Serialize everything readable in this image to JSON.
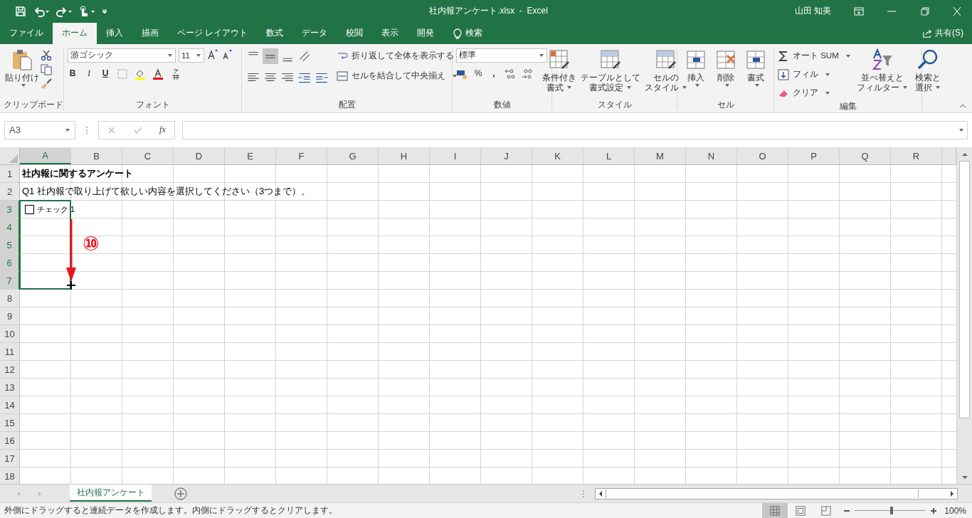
{
  "window": {
    "title": "社内報アンケート.xlsx  -  Excel",
    "user": "山田 知美"
  },
  "ribbon_tabs": [
    {
      "label": "ファイル",
      "selected": false
    },
    {
      "label": "ホーム",
      "selected": true
    },
    {
      "label": "挿入",
      "selected": false
    },
    {
      "label": "描画",
      "selected": false
    },
    {
      "label": "ページ レイアウト",
      "selected": false
    },
    {
      "label": "数式",
      "selected": false
    },
    {
      "label": "データ",
      "selected": false
    },
    {
      "label": "校閲",
      "selected": false
    },
    {
      "label": "表示",
      "selected": false
    },
    {
      "label": "開発",
      "selected": false
    }
  ],
  "tell_me": "検索",
  "share": "共有(S)",
  "clipboard": {
    "paste": "貼り付け",
    "label": "クリップボード"
  },
  "font": {
    "name": "游ゴシック",
    "size": "11",
    "bold": "B",
    "italic": "I",
    "underline": "U",
    "label": "フォント"
  },
  "alignment": {
    "vertical_buttons": [
      {
        "selected": false
      },
      {
        "selected": true
      },
      {
        "selected": false
      }
    ],
    "wrap": "折り返して全体を表示する",
    "merge": "セルを結合して中央揃え",
    "label": "配置"
  },
  "number": {
    "format": "標準",
    "percent": "%",
    "comma": ",",
    "label": "数値"
  },
  "styles": {
    "buttons": [
      [
        "条件付き",
        "書式"
      ],
      [
        "テーブルとして",
        "書式設定"
      ],
      [
        "セルの",
        "スタイル"
      ]
    ],
    "label": "スタイル"
  },
  "cells": {
    "buttons": [
      "挿入",
      "削除",
      "書式"
    ],
    "label": "セル"
  },
  "editing": {
    "autosum": "オート SUM",
    "fill": "フィル",
    "clear": "クリア",
    "sort": [
      "並べ替えと",
      "フィルター"
    ],
    "find": [
      "検索と",
      "選択"
    ],
    "label": "編集"
  },
  "formula_bar": {
    "name_box": "A3",
    "fx": "fx"
  },
  "columns": [
    {
      "label": "A",
      "selected": true
    },
    {
      "label": "B",
      "selected": false
    },
    {
      "label": "C",
      "selected": false
    },
    {
      "label": "D",
      "selected": false
    },
    {
      "label": "E",
      "selected": false
    },
    {
      "label": "F",
      "selected": false
    },
    {
      "label": "G",
      "selected": false
    },
    {
      "label": "H",
      "selected": false
    },
    {
      "label": "I",
      "selected": false
    },
    {
      "label": "J",
      "selected": false
    },
    {
      "label": "K",
      "selected": false
    },
    {
      "label": "L",
      "selected": false
    },
    {
      "label": "M",
      "selected": false
    },
    {
      "label": "N",
      "selected": false
    },
    {
      "label": "O",
      "selected": false
    },
    {
      "label": "P",
      "selected": false
    },
    {
      "label": "Q",
      "selected": false
    },
    {
      "label": "R",
      "selected": false
    }
  ],
  "rows": [
    {
      "number": "1",
      "selected": false,
      "cell": {
        "kind": "title",
        "text": "社内報に関するアンケート"
      }
    },
    {
      "number": "2",
      "selected": false,
      "cell": {
        "kind": "text",
        "text": "Q1 社内報で取り上げて欲しい内容を選択してください（3つまで）。"
      }
    },
    {
      "number": "3",
      "selected": true,
      "cell": {
        "kind": "checkbox",
        "text": "チェック 1",
        "checked": false
      }
    },
    {
      "number": "4",
      "selected": true
    },
    {
      "number": "5",
      "selected": true
    },
    {
      "number": "6",
      "selected": true
    },
    {
      "number": "7",
      "selected": true
    },
    {
      "number": "8",
      "selected": false
    },
    {
      "number": "9",
      "selected": false
    },
    {
      "number": "10",
      "selected": false
    },
    {
      "number": "11",
      "selected": false
    },
    {
      "number": "12",
      "selected": false
    },
    {
      "number": "13",
      "selected": false
    },
    {
      "number": "14",
      "selected": false
    },
    {
      "number": "15",
      "selected": false
    },
    {
      "number": "16",
      "selected": false
    },
    {
      "number": "17",
      "selected": false
    },
    {
      "number": "18",
      "selected": false
    }
  ],
  "annotation": {
    "label": "⑩"
  },
  "sheet_tabs": [
    {
      "label": "社内報アンケート",
      "selected": true
    }
  ],
  "status_bar": {
    "message": "外側にドラッグすると連続データを作成します。内側にドラッグするとクリアします。",
    "views": [
      {
        "selected": true
      },
      {
        "selected": false
      },
      {
        "selected": false
      }
    ],
    "zoom": {
      "level": 0.5,
      "reading": "100%"
    }
  }
}
